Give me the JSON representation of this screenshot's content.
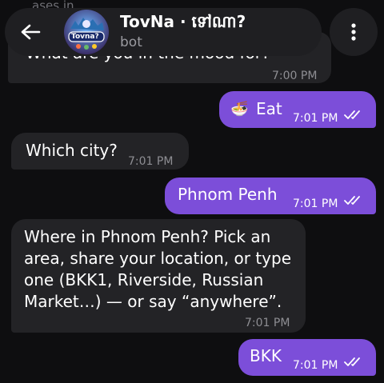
{
  "header": {
    "title": "TovNa · ទៅណា?",
    "subtitle": "bot",
    "avatar_text": "Tovna?",
    "back_icon": "arrow-left-icon",
    "menu_icon": "more-vertical-icon"
  },
  "messages": [
    {
      "direction": "incoming",
      "text": "What are you in the mood for?",
      "time": "7:00 PM",
      "partially_hidden": true
    },
    {
      "direction": "outgoing",
      "emoji": "🍜",
      "text": "Eat",
      "time": "7:01 PM",
      "read": true
    },
    {
      "direction": "incoming",
      "text": "Which city?",
      "time": "7:01 PM"
    },
    {
      "direction": "outgoing",
      "text": "Phnom Penh",
      "time": "7:01 PM",
      "read": true
    },
    {
      "direction": "incoming",
      "lines": [
        "Where in Phnom Penh? Pick an",
        "area, share your location, or type",
        "one (BKK1, Riverside, Russian",
        "Market…) — or say “anywhere”."
      ],
      "time": "7:01 PM"
    },
    {
      "direction": "outgoing",
      "text": "BKK",
      "time": "7:01 PM",
      "read": true
    }
  ],
  "colors": {
    "background": "#0e0e10",
    "incoming_bubble": "#232326",
    "outgoing_bubble": "#7c4ed9",
    "header": "#1f1f22"
  }
}
